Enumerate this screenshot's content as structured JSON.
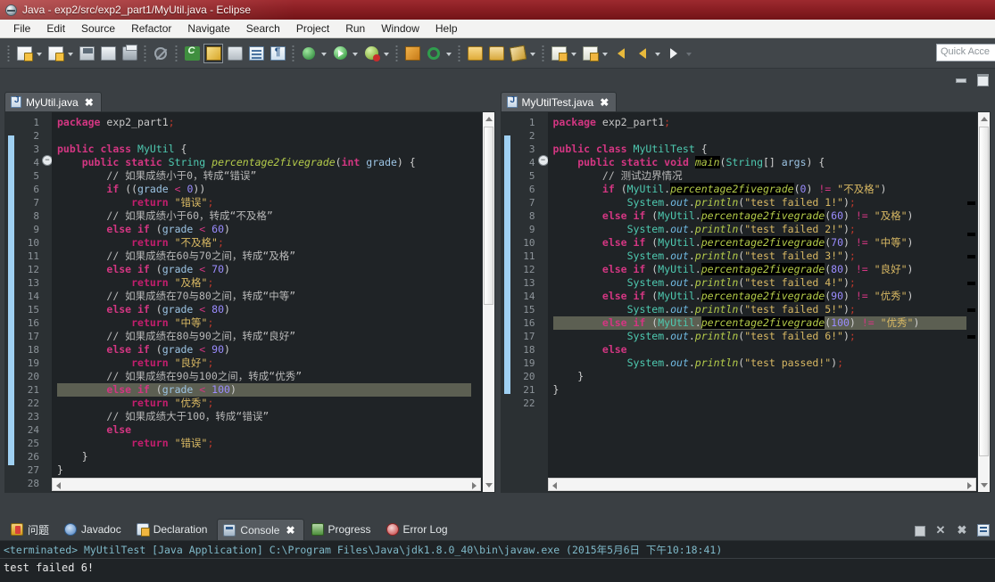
{
  "window": {
    "title": "Java - exp2/src/exp2_part1/MyUtil.java - Eclipse",
    "app_icon": "eclipse-icon"
  },
  "menu": {
    "items": [
      "File",
      "Edit",
      "Source",
      "Refactor",
      "Navigate",
      "Search",
      "Project",
      "Run",
      "Window",
      "Help"
    ]
  },
  "toolbar": {
    "quick_access_placeholder": "Quick Acce",
    "buttons": [
      {
        "name": "new-wizard",
        "icon": "new-document-icon"
      },
      {
        "name": "new-java-project",
        "icon": "new-project-icon"
      },
      {
        "name": "save",
        "icon": "save-icon"
      },
      {
        "name": "save-all",
        "icon": "save-all-icon"
      },
      {
        "name": "print",
        "icon": "print-icon"
      },
      {
        "name": "skip-breakpoints",
        "icon": "skip-all-breakpoints-icon"
      },
      {
        "name": "new-class",
        "icon": "new-class-icon"
      },
      {
        "name": "java-perspective",
        "icon": "java-perspective-icon"
      },
      {
        "name": "search",
        "icon": "search-icon"
      },
      {
        "name": "toggle-block-selection",
        "icon": "block-selection-icon"
      },
      {
        "name": "show-whitespace",
        "icon": "whitespace-icon"
      },
      {
        "name": "debug",
        "icon": "debug-icon"
      },
      {
        "name": "run",
        "icon": "run-icon"
      },
      {
        "name": "run-external-tools",
        "icon": "external-tools-icon"
      },
      {
        "name": "new-junit-test",
        "icon": "junit-icon"
      },
      {
        "name": "coverage",
        "icon": "coverage-icon"
      },
      {
        "name": "open-type",
        "icon": "open-type-icon"
      },
      {
        "name": "open-task",
        "icon": "open-task-icon"
      },
      {
        "name": "annotate",
        "icon": "annotate-icon"
      },
      {
        "name": "previous-annotation",
        "icon": "previous-annotation-icon"
      },
      {
        "name": "next-annotation",
        "icon": "next-annotation-icon"
      },
      {
        "name": "back",
        "icon": "back-arrow-icon"
      },
      {
        "name": "forward",
        "icon": "forward-arrow-icon"
      }
    ]
  },
  "editors": {
    "left": {
      "tab_label": "MyUtil.java",
      "tab_icon": "java-file-icon",
      "close_glyph": "✖",
      "current_line": 21,
      "line_count": 28,
      "lines": [
        {
          "n": 1,
          "fold": false,
          "html": "<span class=\"kw\">package</span> <span class=\"pkg\">exp2_part1</span><span class=\"semi\">;</span>"
        },
        {
          "n": 2,
          "fold": false,
          "html": ""
        },
        {
          "n": 3,
          "fold": false,
          "html": "<span class=\"kw\">public</span> <span class=\"kw\">class</span> <span class=\"cls\">MyUtil</span> <span class=\"punc\">{</span>"
        },
        {
          "n": 4,
          "fold": true,
          "html": "    <span class=\"kw\">public</span> <span class=\"kw\">static</span> <span class=\"type\">String</span> <span class=\"methp\">percentage2fivegrade</span><span class=\"punc\">(</span><span class=\"kw\">int</span> <span class=\"var\">grade</span><span class=\"punc\">) {</span>"
        },
        {
          "n": 5,
          "fold": false,
          "html": "        <span class=\"cmt\">// 如果成绩小于0，转成“错误”</span>"
        },
        {
          "n": 6,
          "fold": false,
          "html": "        <span class=\"kw\">if</span> <span class=\"punc\">((</span><span class=\"var\">grade</span> <span class=\"opr\">&lt;</span> <span class=\"num\">0</span><span class=\"punc\">))</span>"
        },
        {
          "n": 7,
          "fold": false,
          "html": "            <span class=\"kw2\">return</span> <span class=\"str\">\"错误\"</span><span class=\"semi\">;</span>"
        },
        {
          "n": 8,
          "fold": false,
          "html": "        <span class=\"cmt\">// 如果成绩小于60，转成“不及格”</span>"
        },
        {
          "n": 9,
          "fold": false,
          "html": "        <span class=\"kw\">else if</span> <span class=\"punc\">(</span><span class=\"var\">grade</span> <span class=\"opr\">&lt;</span> <span class=\"num\">60</span><span class=\"punc\">)</span>"
        },
        {
          "n": 10,
          "fold": false,
          "html": "            <span class=\"kw2\">return</span> <span class=\"str\">\"不及格\"</span><span class=\"semi\">;</span>"
        },
        {
          "n": 11,
          "fold": false,
          "html": "        <span class=\"cmt\">// 如果成绩在60与70之间，转成“及格”</span>"
        },
        {
          "n": 12,
          "fold": false,
          "html": "        <span class=\"kw\">else if</span> <span class=\"punc\">(</span><span class=\"var\">grade</span> <span class=\"opr\">&lt;</span> <span class=\"num\">70</span><span class=\"punc\">)</span>"
        },
        {
          "n": 13,
          "fold": false,
          "html": "            <span class=\"kw2\">return</span> <span class=\"str\">\"及格\"</span><span class=\"semi\">;</span>"
        },
        {
          "n": 14,
          "fold": false,
          "html": "        <span class=\"cmt\">// 如果成绩在70与80之间，转成“中等”</span>"
        },
        {
          "n": 15,
          "fold": false,
          "html": "        <span class=\"kw\">else if</span> <span class=\"punc\">(</span><span class=\"var\">grade</span> <span class=\"opr\">&lt;</span> <span class=\"num\">80</span><span class=\"punc\">)</span>"
        },
        {
          "n": 16,
          "fold": false,
          "html": "            <span class=\"kw2\">return</span> <span class=\"str\">\"中等\"</span><span class=\"semi\">;</span>"
        },
        {
          "n": 17,
          "fold": false,
          "html": "        <span class=\"cmt\">// 如果成绩在80与90之间，转成“良好”</span>"
        },
        {
          "n": 18,
          "fold": false,
          "html": "        <span class=\"kw\">else if</span> <span class=\"punc\">(</span><span class=\"var\">grade</span> <span class=\"opr\">&lt;</span> <span class=\"num\">90</span><span class=\"punc\">)</span>"
        },
        {
          "n": 19,
          "fold": false,
          "html": "            <span class=\"kw2\">return</span> <span class=\"str\">\"良好\"</span><span class=\"semi\">;</span>"
        },
        {
          "n": 20,
          "fold": false,
          "html": "        <span class=\"cmt\">// 如果成绩在90与100之间，转成“优秀”</span>"
        },
        {
          "n": 21,
          "fold": false,
          "html": "        <span class=\"kw\">else if</span> <span class=\"punc\">(</span><span class=\"var\">grade</span> <span class=\"opr\">&lt;</span> <span class=\"num\">100</span><span class=\"punc\">)</span>"
        },
        {
          "n": 22,
          "fold": false,
          "html": "            <span class=\"kw2\">return</span> <span class=\"str\">\"优秀\"</span><span class=\"semi\">;</span>"
        },
        {
          "n": 23,
          "fold": false,
          "html": "        <span class=\"cmt\">// 如果成绩大于100，转成“错误”</span>"
        },
        {
          "n": 24,
          "fold": false,
          "html": "        <span class=\"kw\">else</span>"
        },
        {
          "n": 25,
          "fold": false,
          "html": "            <span class=\"kw2\">return</span> <span class=\"str\">\"错误\"</span><span class=\"semi\">;</span>"
        },
        {
          "n": 26,
          "fold": false,
          "html": "    <span class=\"punc\">}</span>"
        },
        {
          "n": 27,
          "fold": false,
          "html": "<span class=\"punc\">}</span>"
        },
        {
          "n": 28,
          "fold": false,
          "html": ""
        }
      ]
    },
    "right": {
      "tab_label": "MyUtilTest.java",
      "tab_icon": "java-file-icon",
      "close_glyph": "✖",
      "current_line": 16,
      "line_count": 22,
      "lines": [
        {
          "n": 1,
          "fold": false,
          "html": "<span class=\"kw\">package</span> <span class=\"pkg\">exp2_part1</span><span class=\"semi\">;</span>"
        },
        {
          "n": 2,
          "fold": false,
          "html": ""
        },
        {
          "n": 3,
          "fold": false,
          "html": "<span class=\"kw\">public</span> <span class=\"kw\">class</span> <span class=\"cls\">MyUtilTest</span> <span class=\"punc\">{</span>"
        },
        {
          "n": 4,
          "fold": true,
          "html": "    <span class=\"kw\">public</span> <span class=\"kw\">static</span> <span class=\"kw\">void</span> <span class=\"meth\">main</span><span class=\"punc\">(</span><span class=\"type\">String</span><span class=\"punc\">[]</span> <span class=\"var\">args</span><span class=\"punc\">) {</span>"
        },
        {
          "n": 5,
          "fold": false,
          "html": "        <span class=\"cmt\">// 测试边界情况</span>"
        },
        {
          "n": 6,
          "fold": false,
          "html": "        <span class=\"kw\">if</span> <span class=\"punc\">(</span><span class=\"cls\">MyUtil</span><span class=\"punc\">.</span><span class=\"meth\">percentage2fivegrade</span><span class=\"punc\">(</span><span class=\"num\">0</span><span class=\"punc\">)</span> <span class=\"opr\">!=</span> <span class=\"str\">\"不及格\"</span><span class=\"punc\">)</span>"
        },
        {
          "n": 7,
          "fold": false,
          "html": "            <span class=\"cls\">System</span><span class=\"punc\">.</span><span class=\"fld\">out</span><span class=\"punc\">.</span><span class=\"methp\">println</span><span class=\"punc\">(</span><span class=\"str\">\"test failed 1!\"</span><span class=\"punc\">)</span><span class=\"semi\">;</span>"
        },
        {
          "n": 8,
          "fold": false,
          "html": "        <span class=\"kw\">else if</span> <span class=\"punc\">(</span><span class=\"cls\">MyUtil</span><span class=\"punc\">.</span><span class=\"meth\">percentage2fivegrade</span><span class=\"punc\">(</span><span class=\"num\">60</span><span class=\"punc\">)</span> <span class=\"opr\">!=</span> <span class=\"str\">\"及格\"</span><span class=\"punc\">)</span>"
        },
        {
          "n": 9,
          "fold": false,
          "html": "            <span class=\"cls\">System</span><span class=\"punc\">.</span><span class=\"fld\">out</span><span class=\"punc\">.</span><span class=\"methp\">println</span><span class=\"punc\">(</span><span class=\"str\">\"test failed 2!\"</span><span class=\"punc\">)</span><span class=\"semi\">;</span>"
        },
        {
          "n": 10,
          "fold": false,
          "html": "        <span class=\"kw\">else if</span> <span class=\"punc\">(</span><span class=\"cls\">MyUtil</span><span class=\"punc\">.</span><span class=\"meth\">percentage2fivegrade</span><span class=\"punc\">(</span><span class=\"num\">70</span><span class=\"punc\">)</span> <span class=\"opr\">!=</span> <span class=\"str\">\"中等\"</span><span class=\"punc\">)</span>"
        },
        {
          "n": 11,
          "fold": false,
          "html": "            <span class=\"cls\">System</span><span class=\"punc\">.</span><span class=\"fld\">out</span><span class=\"punc\">.</span><span class=\"methp\">println</span><span class=\"punc\">(</span><span class=\"str\">\"test failed 3!\"</span><span class=\"punc\">)</span><span class=\"semi\">;</span>"
        },
        {
          "n": 12,
          "fold": false,
          "html": "        <span class=\"kw\">else if</span> <span class=\"punc\">(</span><span class=\"cls\">MyUtil</span><span class=\"punc\">.</span><span class=\"meth\">percentage2fivegrade</span><span class=\"punc\">(</span><span class=\"num\">80</span><span class=\"punc\">)</span> <span class=\"opr\">!=</span> <span class=\"str\">\"良好\"</span><span class=\"punc\">)</span>"
        },
        {
          "n": 13,
          "fold": false,
          "html": "            <span class=\"cls\">System</span><span class=\"punc\">.</span><span class=\"fld\">out</span><span class=\"punc\">.</span><span class=\"methp\">println</span><span class=\"punc\">(</span><span class=\"str\">\"test failed 4!\"</span><span class=\"punc\">)</span><span class=\"semi\">;</span>"
        },
        {
          "n": 14,
          "fold": false,
          "html": "        <span class=\"kw\">else if</span> <span class=\"punc\">(</span><span class=\"cls\">MyUtil</span><span class=\"punc\">.</span><span class=\"meth\">percentage2fivegrade</span><span class=\"punc\">(</span><span class=\"num\">90</span><span class=\"punc\">)</span> <span class=\"opr\">!=</span> <span class=\"str\">\"优秀\"</span><span class=\"punc\">)</span>"
        },
        {
          "n": 15,
          "fold": false,
          "html": "            <span class=\"cls\">System</span><span class=\"punc\">.</span><span class=\"fld\">out</span><span class=\"punc\">.</span><span class=\"methp\">println</span><span class=\"punc\">(</span><span class=\"str\">\"test failed 5!\"</span><span class=\"punc\">)</span><span class=\"semi\">;</span>"
        },
        {
          "n": 16,
          "fold": false,
          "html": "        <span class=\"kw\">else if</span> <span class=\"punc\">(</span><span class=\"cls\">MyUtil</span><span class=\"punc\">.</span><span class=\"meth\">percentage2fivegrade</span><span class=\"punc\">(</span><span class=\"num\">100</span><span class=\"punc\">)</span> <span class=\"opr\">!=</span> <span class=\"str\">\"优秀\"</span><span class=\"punc\">)</span>"
        },
        {
          "n": 17,
          "fold": false,
          "html": "            <span class=\"cls\">System</span><span class=\"punc\">.</span><span class=\"fld\">out</span><span class=\"punc\">.</span><span class=\"methp\">println</span><span class=\"punc\">(</span><span class=\"str\">\"test failed 6!\"</span><span class=\"punc\">)</span><span class=\"semi\">;</span>"
        },
        {
          "n": 18,
          "fold": false,
          "html": "        <span class=\"kw\">else</span>"
        },
        {
          "n": 19,
          "fold": false,
          "html": "            <span class=\"cls\">System</span><span class=\"punc\">.</span><span class=\"fld\">out</span><span class=\"punc\">.</span><span class=\"methp\">println</span><span class=\"punc\">(</span><span class=\"str\">\"test passed!\"</span><span class=\"punc\">)</span><span class=\"semi\">;</span>"
        },
        {
          "n": 20,
          "fold": false,
          "html": "    <span class=\"punc\">}</span>"
        },
        {
          "n": 21,
          "fold": false,
          "html": "<span class=\"punc\">}</span>"
        },
        {
          "n": 22,
          "fold": false,
          "html": ""
        }
      ]
    }
  },
  "bottom_view": {
    "tabs": [
      {
        "label": "问题",
        "icon": "problems-icon",
        "active": false
      },
      {
        "label": "Javadoc",
        "icon": "javadoc-icon",
        "active": false
      },
      {
        "label": "Declaration",
        "icon": "declaration-icon",
        "active": false
      },
      {
        "label": "Console",
        "icon": "console-icon",
        "active": true
      },
      {
        "label": "Progress",
        "icon": "progress-icon",
        "active": false
      },
      {
        "label": "Error Log",
        "icon": "error-log-icon",
        "active": false
      }
    ],
    "close_glyph": "✖",
    "console": {
      "terminated_line": "<terminated> MyUtilTest [Java Application] C:\\Program Files\\Java\\jdk1.8.0_40\\bin\\javaw.exe (2015年5月6日 下午10:18:41)",
      "output": "test failed 6!"
    },
    "tools": [
      {
        "name": "terminate-button",
        "icon": "stop-icon",
        "glyph": ""
      },
      {
        "name": "remove-launch-button",
        "icon": "close-icon",
        "glyph": "✕"
      },
      {
        "name": "remove-all-terminated-button",
        "icon": "close-all-icon",
        "glyph": "✖"
      },
      {
        "name": "pin-console-button",
        "icon": "pin-icon",
        "glyph": ""
      }
    ]
  },
  "editor_controls": {
    "minimize": "minimize-icon",
    "maximize": "maximize-icon"
  },
  "colors": {
    "title_red": "#8b1f24",
    "toolbar_bg": "#41464a",
    "editor_bg": "#1f2326",
    "current_line": "#5c5f52",
    "accent_tab": "#565b60"
  }
}
